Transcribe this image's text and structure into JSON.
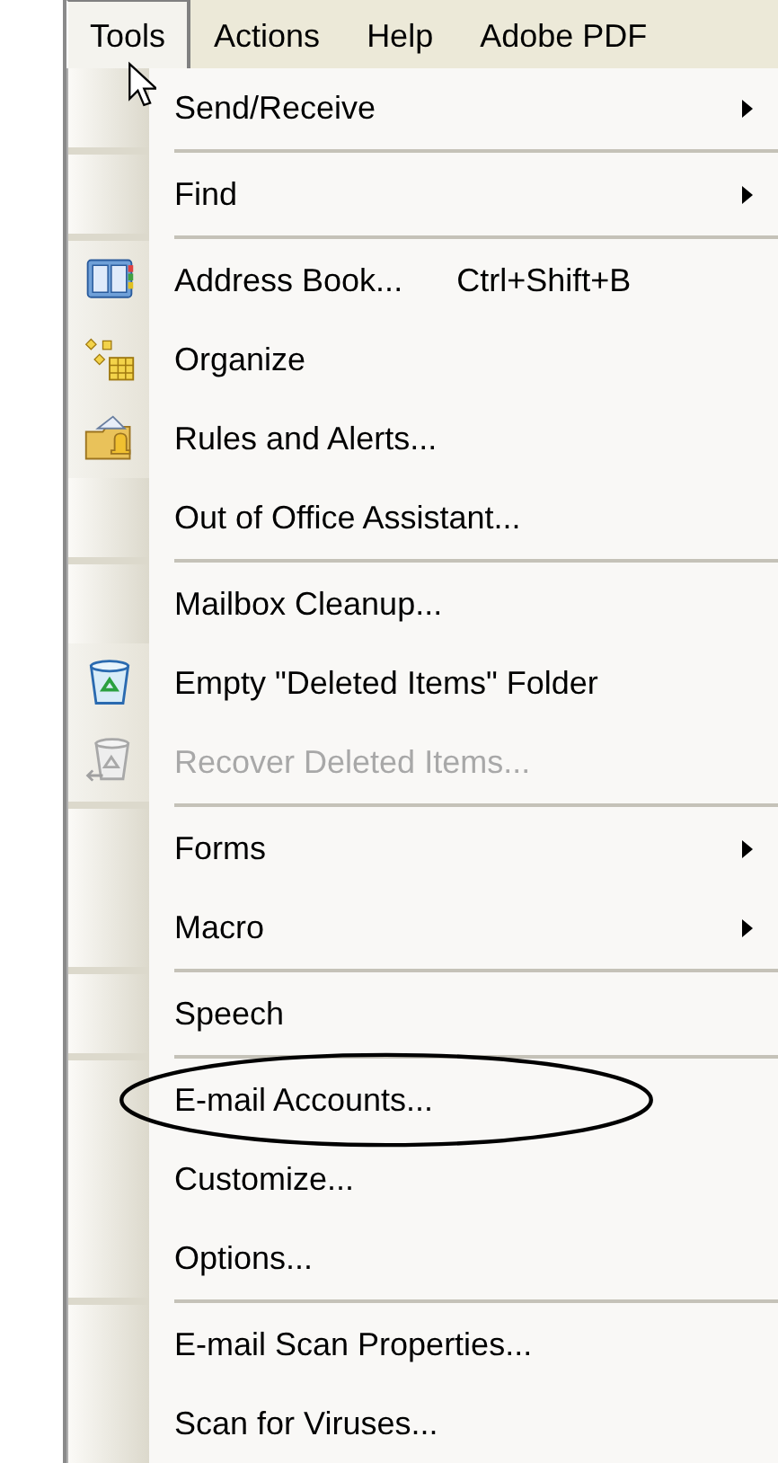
{
  "menu_bar": [
    {
      "label": "Tools",
      "selected": true
    },
    {
      "label": "Actions",
      "selected": false
    },
    {
      "label": "Help",
      "selected": false
    },
    {
      "label": "Adobe PDF",
      "selected": false
    }
  ],
  "menu": {
    "groups": [
      [
        {
          "label": "Send/Receive",
          "kind": "submenu",
          "disabled": false,
          "annotated": false
        }
      ],
      [
        {
          "label": "Find",
          "kind": "submenu",
          "disabled": false,
          "annotated": false
        }
      ],
      [
        {
          "label": "Address Book...",
          "kind": "command",
          "shortcut": "Ctrl+Shift+B",
          "disabled": false,
          "annotated": false
        },
        {
          "label": "Organize",
          "kind": "command",
          "disabled": false,
          "annotated": false
        },
        {
          "label": "Rules and Alerts...",
          "kind": "command",
          "disabled": false,
          "annotated": false
        },
        {
          "label": "Out of Office Assistant...",
          "kind": "command",
          "disabled": false,
          "annotated": false
        }
      ],
      [
        {
          "label": "Mailbox Cleanup...",
          "kind": "command",
          "disabled": false,
          "annotated": false
        },
        {
          "label": "Empty \"Deleted Items\" Folder",
          "kind": "command",
          "disabled": false,
          "annotated": false
        },
        {
          "label": "Recover Deleted Items...",
          "kind": "command",
          "disabled": true,
          "annotated": false
        }
      ],
      [
        {
          "label": "Forms",
          "kind": "submenu",
          "disabled": false,
          "annotated": false
        },
        {
          "label": "Macro",
          "kind": "submenu",
          "disabled": false,
          "annotated": false
        }
      ],
      [
        {
          "label": "Speech",
          "kind": "command",
          "disabled": false,
          "annotated": false
        }
      ],
      [
        {
          "label": "E-mail Accounts...",
          "kind": "command",
          "disabled": false,
          "annotated": true
        },
        {
          "label": "Customize...",
          "kind": "command",
          "disabled": false,
          "annotated": false
        },
        {
          "label": "Options...",
          "kind": "command",
          "disabled": false,
          "annotated": false
        }
      ],
      [
        {
          "label": "E-mail Scan Properties...",
          "kind": "command",
          "disabled": false,
          "annotated": false
        },
        {
          "label": "Scan for Viruses...",
          "kind": "command",
          "disabled": false,
          "annotated": false
        }
      ]
    ]
  }
}
